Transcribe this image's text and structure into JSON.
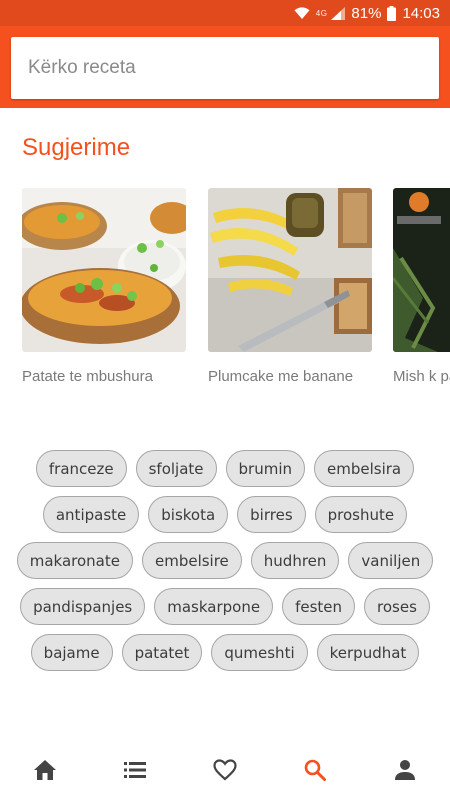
{
  "status_bar": {
    "network_label": "4G",
    "battery_percent": "81%",
    "time": "14:03"
  },
  "search": {
    "placeholder": "Kërko receta",
    "value": ""
  },
  "suggestions": {
    "title": "Sugjerime",
    "items": [
      {
        "title": "Patate te mbushura"
      },
      {
        "title": "Plumcake me banane"
      },
      {
        "title": "Mish k patate"
      }
    ]
  },
  "tags": {
    "rows": [
      [
        "franceze",
        "sfoljate",
        "brumin",
        "embelsira"
      ],
      [
        "antipaste",
        "biskota",
        "birres",
        "proshute"
      ],
      [
        "makaronate",
        "embelsire",
        "hudhren",
        "vaniljen"
      ],
      [
        "pandispanjes",
        "maskarpone",
        "festen",
        "roses"
      ],
      [
        "bajame",
        "patatet",
        "qumeshti",
        "kerpudhat"
      ]
    ]
  },
  "bottom_nav": {
    "items": [
      {
        "icon": "home-icon",
        "active": false
      },
      {
        "icon": "list-icon",
        "active": false
      },
      {
        "icon": "heart-icon",
        "active": false
      },
      {
        "icon": "search-icon",
        "active": true
      },
      {
        "icon": "person-icon",
        "active": false
      }
    ]
  },
  "colors": {
    "primary": "#f5511e",
    "status_bar": "#e14a1c",
    "accent_text": "#f4511e",
    "nav_inactive": "#444444"
  }
}
